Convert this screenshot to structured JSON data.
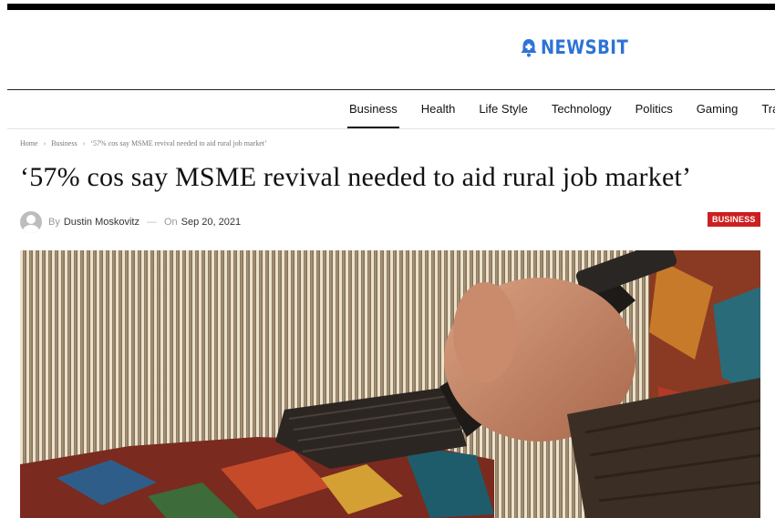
{
  "site": {
    "name": "NEWSBIT",
    "logo_icon": "bell-icon",
    "brand_color": "#2d73d6"
  },
  "nav": {
    "items": [
      "Business",
      "Health",
      "Life Style",
      "Technology",
      "Politics",
      "Gaming",
      "Tra"
    ],
    "active": "Business"
  },
  "breadcrumb": {
    "items": [
      "Home",
      "Business",
      "‘57% cos say MSME revival needed to aid rural job market’"
    ],
    "separator": "›"
  },
  "article": {
    "title": "‘57% cos say MSME revival needed to aid rural job market’",
    "by_label": "By",
    "author": "Dustin Moskovitz",
    "on_label": "On",
    "date": "Sep 20, 2021",
    "category_badge": "BUSINESS",
    "badge_color": "#cc1f1f"
  }
}
